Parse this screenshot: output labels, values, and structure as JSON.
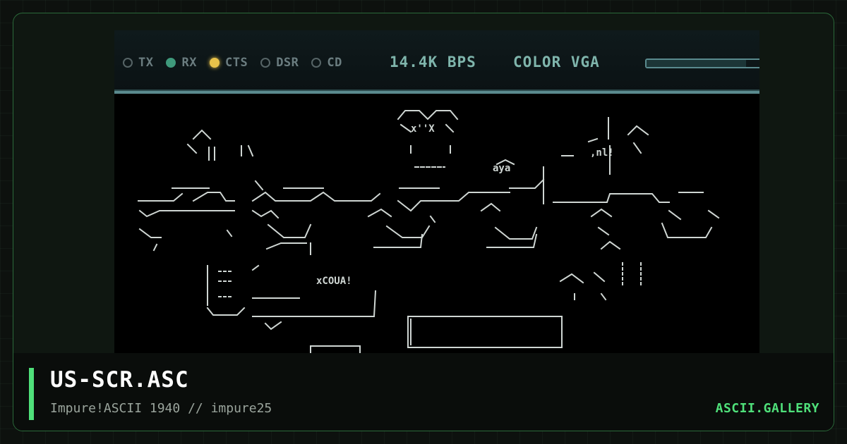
{
  "status_bar": {
    "leds": [
      {
        "label": "TX",
        "state": "off"
      },
      {
        "label": "RX",
        "state": "on"
      },
      {
        "label": "CTS",
        "state": "active"
      },
      {
        "label": "DSR",
        "state": "off"
      },
      {
        "label": "CD",
        "state": "off"
      }
    ],
    "speed": "14.4K BPS",
    "video_mode": "COLOR VGA",
    "transfer_progress": 0.85
  },
  "artwork": {
    "title": "US-SCR.ASC",
    "credit": "Impure!ASCII 1940 // impure25"
  },
  "brand": "ASCII.GALLERY",
  "colors": {
    "accent": "#4fe07a",
    "led_rx": "#3f9a7c",
    "led_cts": "#e8c24a",
    "status_text": "#7fb5ac"
  }
}
